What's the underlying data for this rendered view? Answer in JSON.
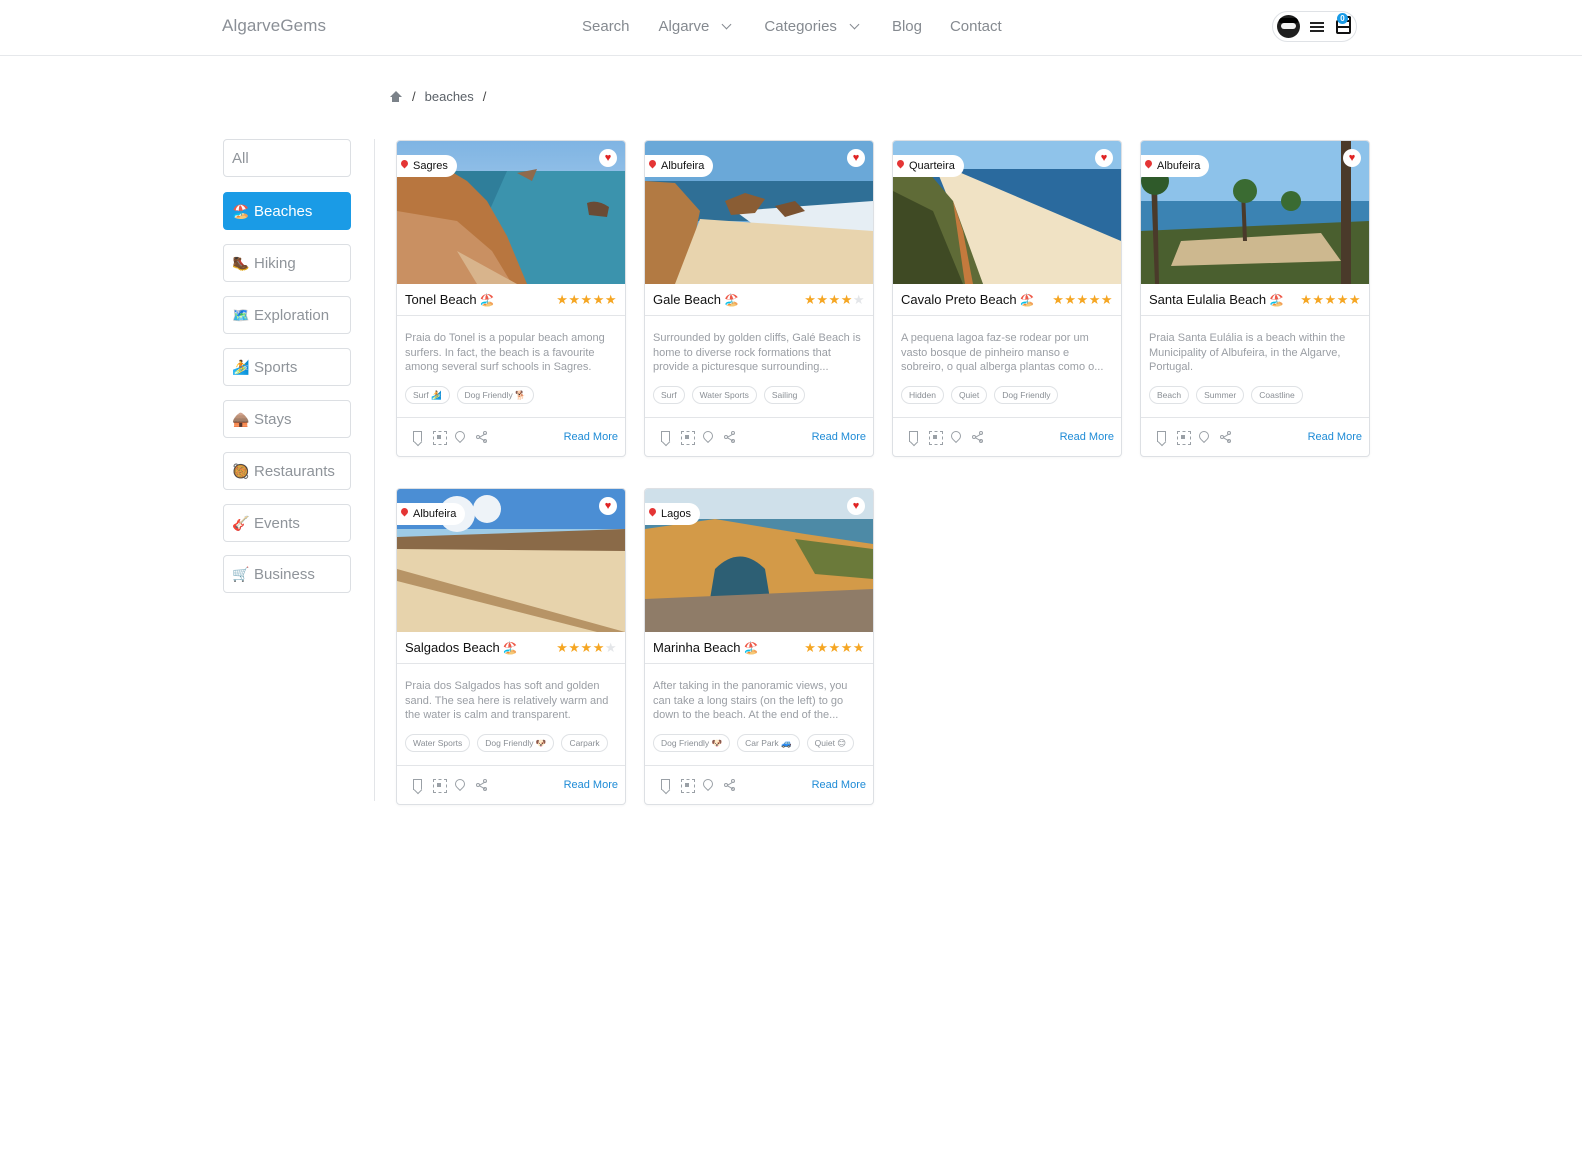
{
  "header": {
    "brand": "AlgarveGems",
    "nav": [
      {
        "label": "Search"
      },
      {
        "label": "Algarve"
      },
      {
        "label": "Categories"
      },
      {
        "label": "Blog"
      },
      {
        "label": "Contact"
      }
    ],
    "cart_count": "0"
  },
  "breadcrumb": {
    "items": [
      "beaches"
    ],
    "separator": "/"
  },
  "sidebar": {
    "items": [
      {
        "label": "All",
        "emoji": ""
      },
      {
        "label": "Beaches",
        "emoji": "🏖️",
        "active": true
      },
      {
        "label": "Hiking",
        "emoji": "🥾"
      },
      {
        "label": "Exploration",
        "emoji": "🗺️"
      },
      {
        "label": "Sports",
        "emoji": "🏄"
      },
      {
        "label": "Stays",
        "emoji": "🛖"
      },
      {
        "label": "Restaurants",
        "emoji": "🥘"
      },
      {
        "label": "Events",
        "emoji": "🎸"
      },
      {
        "label": "Business",
        "emoji": "🛒"
      }
    ]
  },
  "cards": [
    {
      "location": "Sagres",
      "title": "Tonel Beach",
      "title_emoji": "🏖️",
      "rating": 5,
      "description": "Praia do Tonel is a popular beach among surfers. In fact, the beach is a favourite among several surf schools in Sagres.",
      "tags": [
        "Surf 🏄",
        "Dog Friendly 🐕"
      ],
      "read_more": "Read More"
    },
    {
      "location": "Albufeira",
      "title": "Gale Beach",
      "title_emoji": "🏖️",
      "rating": 4,
      "description": "Surrounded by golden cliffs, Galé Beach is home to diverse rock formations that provide a picturesque surrounding...",
      "tags": [
        "Surf",
        "Water Sports",
        "Sailing"
      ],
      "read_more": "Read More"
    },
    {
      "location": "Quarteira",
      "title": "Cavalo Preto Beach",
      "title_emoji": "🏖️",
      "rating": 5,
      "description": "A pequena lagoa faz-se rodear por um vasto bosque de pinheiro manso e sobreiro, o qual alberga plantas como o...",
      "tags": [
        "Hidden",
        "Quiet",
        "Dog Friendly"
      ],
      "read_more": "Read More"
    },
    {
      "location": "Albufeira",
      "title": "Santa Eulalia Beach",
      "title_emoji": "🏖️",
      "rating": 5,
      "description": "Praia Santa Eulália is a beach within the Municipality of Albufeira, in the Algarve, Portugal.",
      "tags": [
        "Beach",
        "Summer",
        "Coastline"
      ],
      "read_more": "Read More"
    },
    {
      "location": "Albufeira",
      "title": "Salgados Beach",
      "title_emoji": "🏖️",
      "rating": 4,
      "description": "Praia dos Salgados has soft and golden sand. The sea here is relatively warm and the water is calm and transparent.",
      "tags": [
        "Water Sports",
        "Dog Friendly 🐶",
        "Carpark"
      ],
      "read_more": "Read More"
    },
    {
      "location": "Lagos",
      "title": "Marinha Beach",
      "title_emoji": "🏖️",
      "rating": 5,
      "description": "After taking in the panoramic views, you can take a long stairs (on the left) to go down to the beach. At the end of the...",
      "tags": [
        "Dog Friendly 🐶",
        "Car Park 🚙",
        "Quiet 😊"
      ],
      "read_more": "Read More"
    }
  ],
  "colors": {
    "accent": "#1a9be6",
    "star": "#f5a623",
    "heart": "#e02424",
    "link": "#1e8bd6"
  }
}
